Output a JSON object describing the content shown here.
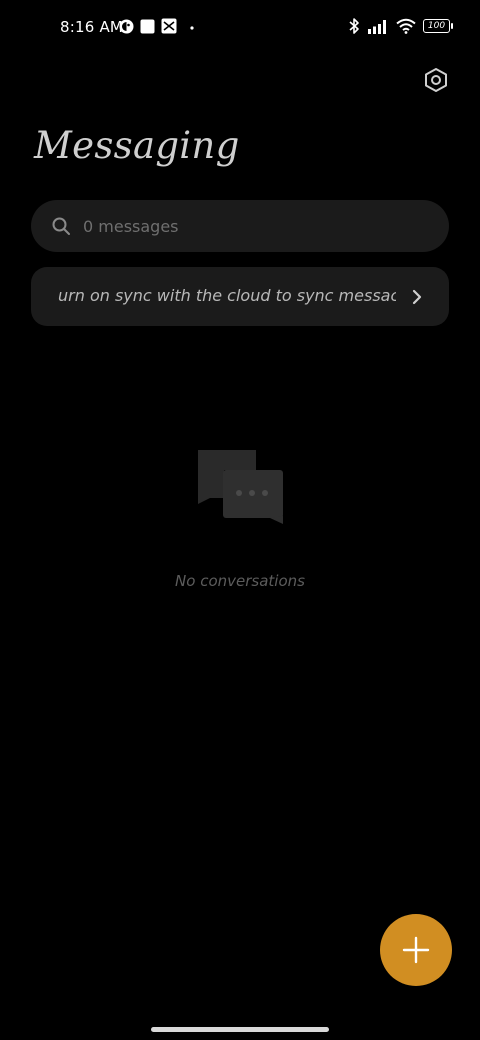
{
  "status_bar": {
    "time": "8:16 AM",
    "battery": "100",
    "left_icons": [
      "face-icon",
      "square-icon",
      "sync-box-icon",
      "dot-icon"
    ],
    "right_icons": [
      "bluetooth-icon",
      "signal-icon",
      "wifi-icon",
      "battery-icon"
    ]
  },
  "header": {
    "title": "Messaging",
    "settings_icon": "settings-hexagon-icon"
  },
  "search": {
    "placeholder": "0 messages",
    "icon": "search-icon"
  },
  "sync_banner": {
    "text": "urn on sync with the cloud to sync messac",
    "chevron_icon": "chevron-right-icon"
  },
  "empty_state": {
    "icon": "chat-bubbles-icon",
    "text": "No conversations"
  },
  "fab": {
    "icon": "plus-icon",
    "color": "#d18e22"
  },
  "colors": {
    "background": "#000000",
    "card": "#1b1b1b",
    "accent": "#d18e22"
  }
}
